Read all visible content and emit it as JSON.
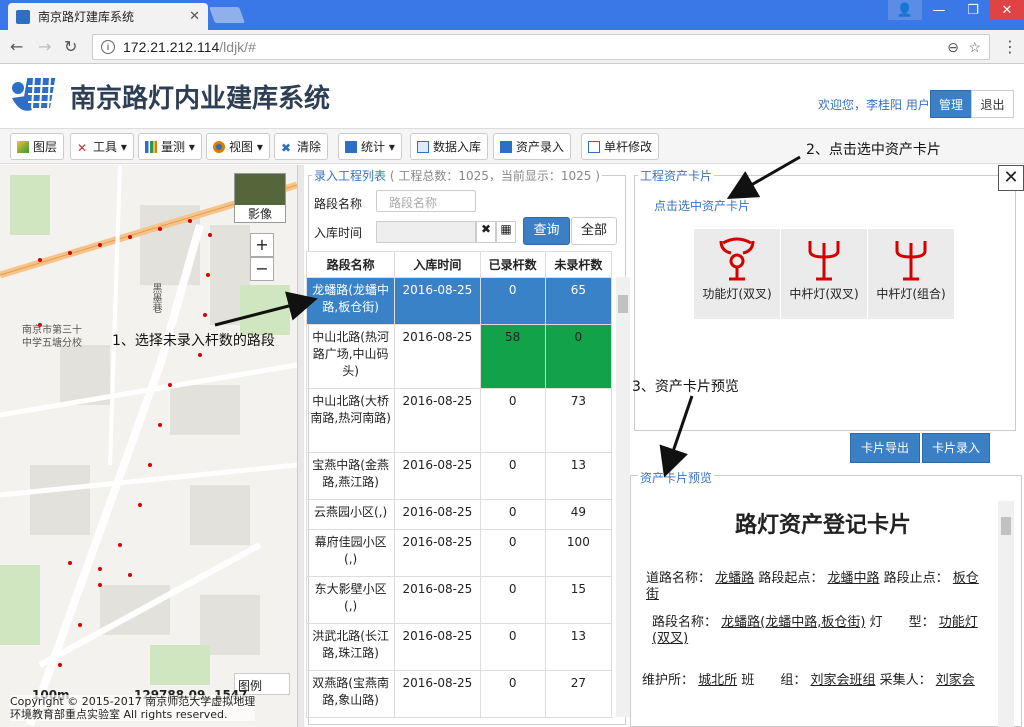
{
  "browser": {
    "tab_title": "南京路灯建库系统",
    "url_host": "172.21.212.114",
    "url_path": "/ldjk/#"
  },
  "header": {
    "title": "南京路灯内业建库系统",
    "welcome": "欢迎您，李桂阳 用户",
    "manage": "管理",
    "exit": "退出"
  },
  "toolbar": [
    {
      "label": "图层",
      "icon": "layers-icon"
    },
    {
      "label": "工具",
      "icon": "tools-icon"
    },
    {
      "label": "量测",
      "icon": "measure-icon"
    },
    {
      "label": "视图",
      "icon": "view-icon"
    },
    {
      "label": "清除",
      "icon": "clear-icon"
    },
    {
      "label": "统计",
      "icon": "stats-icon"
    },
    {
      "label": "数据入库",
      "icon": "import-icon"
    },
    {
      "label": "资产录入",
      "icon": "asset-entry-icon"
    },
    {
      "label": "单杆修改",
      "icon": "edit-pole-icon"
    }
  ],
  "map": {
    "imagery": "影像",
    "zoom_in": "+",
    "zoom_out": "−",
    "legend": "图例",
    "scale": "100m",
    "coords": "129788.09, 1547",
    "copyright": "Copyright © 2015-2017 南京师范大学虚拟地理",
    "copyright2": "环境教育部重点实验室 All rights reserved.",
    "label_school": "南京市第三十",
    "label_school2": "中学五塘分校",
    "label_road": "黑墨巷"
  },
  "list": {
    "legend": "录入工程列表",
    "count": "( 工程总数：1025，当前显示：1025 )",
    "road_label": "路段名称",
    "road_placeholder": "路段名称",
    "time_label": "入库时间",
    "query": "查询",
    "all": "全部",
    "columns": [
      "路段名称",
      "入库时间",
      "已录杆数",
      "未录杆数"
    ],
    "rows": [
      [
        "龙蟠路(龙蟠中路,板仓街)",
        "2016-08-25",
        "0",
        "65"
      ],
      [
        "中山北路(热河路广场,中山码头)",
        "2016-08-25",
        "58",
        "0"
      ],
      [
        "中山北路(大桥南路,热河南路)",
        "2016-08-25",
        "0",
        "73"
      ],
      [
        "宝燕中路(金燕路,燕江路)",
        "2016-08-25",
        "0",
        "13"
      ],
      [
        "云燕园小区(,)",
        "2016-08-25",
        "0",
        "49"
      ],
      [
        "幕府佳园小区(,)",
        "2016-08-25",
        "0",
        "100"
      ],
      [
        "东大影壁小区(,)",
        "2016-08-25",
        "0",
        "15"
      ],
      [
        "洪武北路(长江路,珠江路)",
        "2016-08-25",
        "0",
        "13"
      ],
      [
        "双燕路(宝燕南路,象山路)",
        "2016-08-25",
        "0",
        "27"
      ]
    ]
  },
  "cards": {
    "legend": "工程资产卡片",
    "hint": "点击选中资产卡片",
    "items": [
      "功能灯(双叉)",
      "中杆灯(双叉)",
      "中杆灯(组合)"
    ],
    "export": "卡片导出",
    "entry": "卡片录入"
  },
  "preview": {
    "legend": "资产卡片预览",
    "title": "路灯资产登记卡片",
    "road_name_label": "道路名称：",
    "road_name": "龙蟠路",
    "start_label": "路段起点：",
    "start": "龙蟠中路",
    "end_label": "路段止点：",
    "end": "板仓街",
    "seg_label": "路段名称：",
    "seg": "龙蟠路(龙蟠中路,板仓街)",
    "type_label": "灯　　型：",
    "type": "功能灯(双叉)",
    "maint_label": "维护所：",
    "maint": "城北所",
    "team_label": "班　　组：",
    "team": "刘家会班组",
    "collector_label": "采集人：",
    "collector": "刘家会"
  },
  "annotations": {
    "a1": "1、选择未录入杆数的路段",
    "a2": "2、点击选中资产卡片",
    "a3": "3、资产卡片预览"
  },
  "colors": {
    "accent": "#3b7fc4",
    "selected_row": "#3a82c8",
    "complete_row": "#12a34a",
    "lamp": "#d40000"
  }
}
